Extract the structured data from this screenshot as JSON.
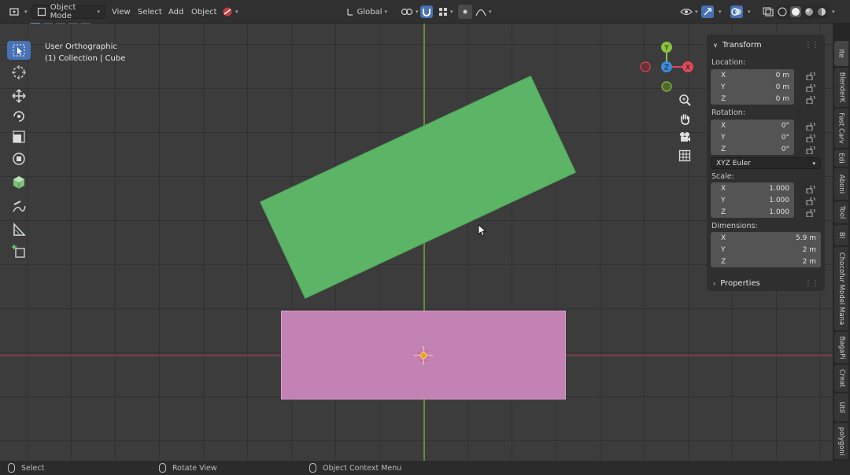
{
  "header": {
    "mode": "Object Mode",
    "menus": [
      "View",
      "Select",
      "Add",
      "Object"
    ],
    "orientation": "Global"
  },
  "viewport": {
    "view_name": "User Orthographic",
    "context": "(1) Collection | Cube",
    "gizmo_axes": [
      "Y",
      "Z",
      "X"
    ]
  },
  "npanel": {
    "transform_label": "Transform",
    "location_label": "Location:",
    "location": [
      {
        "axis": "X",
        "value": "0 m"
      },
      {
        "axis": "Y",
        "value": "0 m"
      },
      {
        "axis": "Z",
        "value": "0 m"
      }
    ],
    "rotation_label": "Rotation:",
    "rotation": [
      {
        "axis": "X",
        "value": "0°"
      },
      {
        "axis": "Y",
        "value": "0°"
      },
      {
        "axis": "Z",
        "value": "0°"
      }
    ],
    "rotation_mode": "XYZ Euler",
    "scale_label": "Scale:",
    "scale": [
      {
        "axis": "X",
        "value": "1.000"
      },
      {
        "axis": "Y",
        "value": "1.000"
      },
      {
        "axis": "Z",
        "value": "1.000"
      }
    ],
    "dimensions_label": "Dimensions:",
    "dimensions": [
      {
        "axis": "X",
        "value": "5.9 m"
      },
      {
        "axis": "Y",
        "value": "2 m"
      },
      {
        "axis": "Z",
        "value": "2 m"
      }
    ],
    "properties_label": "Properties"
  },
  "tabs": [
    "Ite",
    "BlenderK",
    "Fast Carv",
    "Edi",
    "Aboni",
    "Tool",
    "Bl",
    "Chocofur Model Mana",
    "BagaPi",
    "Creat",
    "Util",
    "polygoni"
  ],
  "status": {
    "select": "Select",
    "rotate": "Rotate View",
    "context_menu": "Object Context Menu"
  },
  "colors": {
    "accent": "#4772b3",
    "green_object": "#5cb567",
    "pink_object": "#c282b3",
    "axis_x": "#e0485a",
    "axis_y": "#8ac33c",
    "axis_z": "#3b8cdb"
  }
}
